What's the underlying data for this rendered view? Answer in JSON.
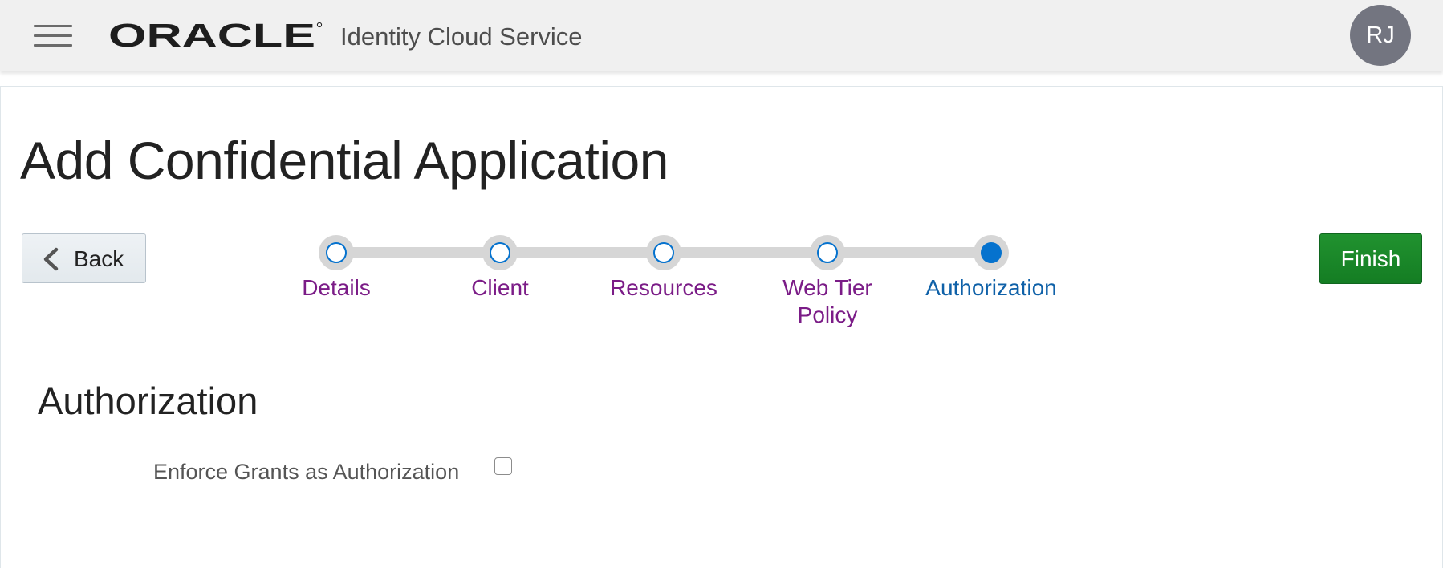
{
  "header": {
    "brand": "ORACLE",
    "service_name": "Identity Cloud Service",
    "avatar_initials": "RJ",
    "icons": {
      "menu": "hamburger-menu-icon"
    }
  },
  "page": {
    "title": "Add Confidential Application"
  },
  "navigation": {
    "back_label": "Back",
    "finish_label": "Finish"
  },
  "steps": [
    {
      "label": "Details",
      "state": "visited"
    },
    {
      "label": "Client",
      "state": "visited"
    },
    {
      "label": "Resources",
      "state": "visited"
    },
    {
      "label": "Web Tier\nPolicy",
      "state": "visited"
    },
    {
      "label": "Authorization",
      "state": "current"
    }
  ],
  "section": {
    "title": "Authorization",
    "fields": [
      {
        "label": "Enforce Grants as Authorization",
        "checked": false
      }
    ]
  },
  "colors": {
    "header_bg": "#f0f0f0",
    "avatar_bg": "#737580",
    "step_visited": "#7b1c87",
    "step_current": "#0f61a8",
    "step_dot": "#0572ce",
    "finish_bg": "#1a8a2a"
  }
}
